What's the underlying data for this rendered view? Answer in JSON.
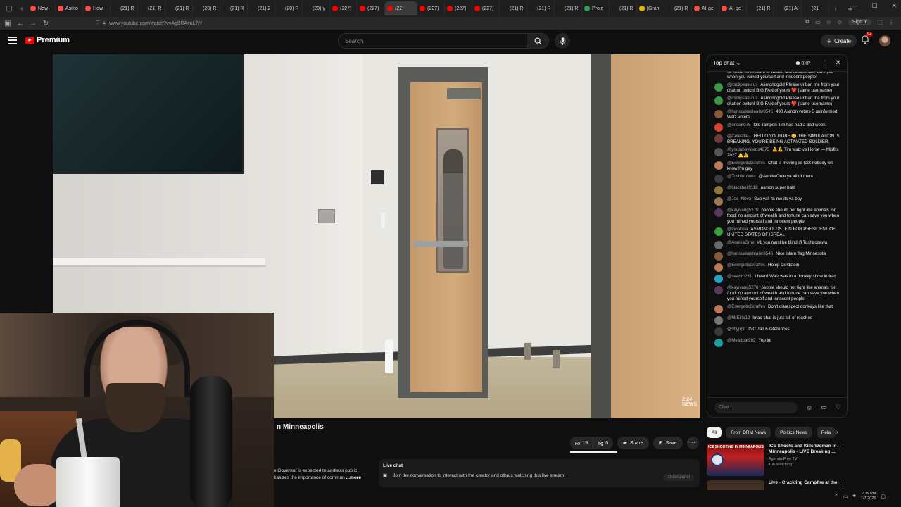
{
  "browser": {
    "tabs": [
      {
        "label": "New",
        "color": "#ff4e45"
      },
      {
        "label": "Asmo",
        "color": "#ff4e45"
      },
      {
        "label": "How",
        "color": "#ff4e45"
      },
      {
        "label": "(21) R",
        "color": "#1d1d1d"
      },
      {
        "label": "(21) R",
        "color": "#1d1d1d"
      },
      {
        "label": "(21) R",
        "color": "#1d1d1d"
      },
      {
        "label": "(20) R",
        "color": "#1d1d1d"
      },
      {
        "label": "(21) R",
        "color": "#1d1d1d"
      },
      {
        "label": "(21) 2",
        "color": "#1d1d1d"
      },
      {
        "label": "(20) R",
        "color": "#1d1d1d"
      },
      {
        "label": "(20) y",
        "color": "#1d1d1d"
      },
      {
        "label": "(227)",
        "color": "#ff0000"
      },
      {
        "label": "(227)",
        "color": "#ff0000"
      },
      {
        "label": "(22",
        "color": "#ff0000"
      },
      {
        "label": "(227)",
        "color": "#ff0000"
      },
      {
        "label": "(227)",
        "color": "#ff0000"
      },
      {
        "label": "(227)",
        "color": "#ff0000"
      },
      {
        "label": "(21) R",
        "color": "#1d1d1d"
      },
      {
        "label": "(21) R",
        "color": "#1d1d1d"
      },
      {
        "label": "(21) R",
        "color": "#1d1d1d"
      },
      {
        "label": "Proje",
        "color": "#2e9e4f"
      },
      {
        "label": "(21) R",
        "color": "#1d1d1d"
      },
      {
        "label": "[Gran",
        "color": "#e6b800"
      },
      {
        "label": "(21) R",
        "color": "#1d1d1d"
      },
      {
        "label": "AI-ge",
        "color": "#ff4e45"
      },
      {
        "label": "AI-ge",
        "color": "#ff4e45"
      },
      {
        "label": "(21) R",
        "color": "#1d1d1d"
      },
      {
        "label": "(21) A",
        "color": "#1d1d1d"
      },
      {
        "label": "(21",
        "color": "#1d1d1d"
      }
    ],
    "active_tab_index": 13,
    "url": "www.youtube.com/watch?v=AgBBAcnL7jY",
    "signin_label": "Sign in"
  },
  "header": {
    "logo_label": "Premium",
    "search_placeholder": "Search",
    "create_label": "Create",
    "notif_count": "9+"
  },
  "video": {
    "title_fragment": "n Minneapolis",
    "watermark": "2:24 NEWS"
  },
  "actions": {
    "likes": "19",
    "dislikes": "0",
    "share_label": "Share",
    "save_label": "Save"
  },
  "description": {
    "line1": "e Governor is expected to address public",
    "line2": "hasizes the importance of commun",
    "more_label": "...more"
  },
  "livechat_box": {
    "title": "Live chat",
    "text": "Join the conversation to interact with the creator and others watching this live stream.",
    "open_panel_label": "Open panel"
  },
  "chat": {
    "header_title": "Top chat",
    "xp_label": "0XP",
    "input_placeholder": "Chat...",
    "top_cut": "for food! no amount of wealth and fortune can save you when you ruined yourself and innocent people!",
    "messages": [
      {
        "user": "@itsclipsasurus",
        "text": "Asmondgold Please unban me from your chat on twitch! BIG FAN of yours ❤️ (same username)",
        "color": "#3a9a45"
      },
      {
        "user": "@itsclipsasurus",
        "text": "Asmondgold Please unban me from your chat on twitch! BIG FAN of yours ❤️ (same username)",
        "color": "#3a9a45"
      },
      {
        "user": "@hanscakestealer8546",
        "text": "490 Asmon voters 5 uninformed Walz voters",
        "color": "#8a5a3a"
      },
      {
        "user": "@erice6075",
        "text": "Ole Tampon Tim has had a bad week.",
        "color": "#d6452b"
      },
      {
        "user": "@Celestial-.",
        "text": "HELLO YOUTUBE 😀 THE SIMULATION IS BREAKING, YOU'RE BEING ACTIVATED SOLDIER.",
        "color": "#6e3a3a"
      },
      {
        "user": "@youtubevideos4675",
        "text": "⚠️⚠️ Tim walz vs Horse — Misfits 2027 ⚠️⚠️",
        "color": "#555555"
      },
      {
        "user": "@EnergeticGiraffes",
        "text": "Chat is moving so fast nobody will know I'm gay",
        "color": "#c07a5a"
      },
      {
        "user": "@Toshirozawa",
        "text": "@AnnikaOme ya all of them",
        "color": "#3d3d3d"
      },
      {
        "user": "@blackhell9118",
        "text": "asmon super bald",
        "color": "#8c7a3a"
      },
      {
        "user": "@Joe_Nova",
        "text": "Sup yall its me its ya boy",
        "color": "#9a7a5a"
      },
      {
        "user": "@kayivang5270",
        "text": "people should not fight like animals for food! no amount of wealth and fortune can save you when you ruined yourself and innocent people!",
        "color": "#5a3a5a"
      },
      {
        "user": "@Gookola",
        "text": "ASMONGOLDSTEIN FOR PRESIDENT OF UNITED STATES OF ISREAL",
        "color": "#3aa03a"
      },
      {
        "user": "@AnnikaOme",
        "text": "#1 you must be blind @Toshirozawa",
        "color": "#6a6a6a"
      },
      {
        "user": "@hanscakestealer8546",
        "text": "Nice Islam flag Minnesota",
        "color": "#8a5a3a"
      },
      {
        "user": "@EnergeticGiraffes",
        "text": "Hotep Goldstein",
        "color": "#c07a5a"
      },
      {
        "user": "@seanm231",
        "text": "I heard Walz was in a donkey show in Iraq",
        "color": "#2aa0c0"
      },
      {
        "user": "@kayivang5270",
        "text": "people should not fight like animals for food! no amount of wealth and fortune can save you when you ruined yourself and innocent people!",
        "color": "#5a3a5a"
      },
      {
        "user": "@EnergeticGiraffes",
        "text": "Don't disrespect donkeys like that",
        "color": "#c07a5a"
      },
      {
        "user": "@MrElite19",
        "text": "lmao chat is just full of roaches",
        "color": "#777777"
      },
      {
        "user": "@shyppd",
        "text": "INC Jan 6 references",
        "color": "#3a3a3a"
      },
      {
        "user": "@Meatloaf992",
        "text": "Yep lol",
        "color": "#1aa0a0"
      }
    ]
  },
  "chips": [
    "All",
    "From DRM News",
    "Politics News",
    "Rela"
  ],
  "recommendations": [
    {
      "title": "ICE Shoots and Kills Woman in Minneapolis - LIVE Breaking ...",
      "channel": "Agenda-Free TV",
      "meta": "10K watching",
      "thumb_label": "ICE SHOOTING IN MINNEAPOLIS"
    },
    {
      "title": "Live - Crackling Campfire at the",
      "channel": "",
      "meta": "",
      "thumb_label": ""
    }
  ],
  "taskbar": {
    "time": "2:36 PM",
    "date": "1/7/2026"
  }
}
